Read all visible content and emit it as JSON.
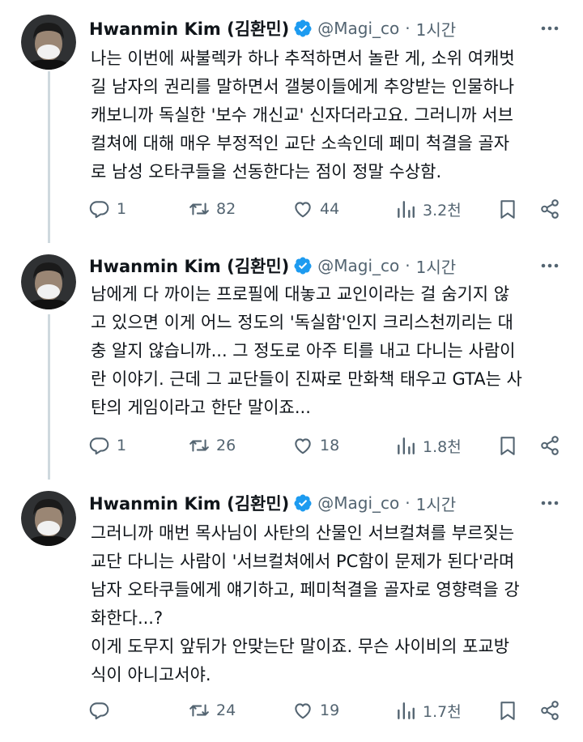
{
  "author": {
    "name": "Hwanmin Kim (김환민)",
    "handle": "@Magi_co",
    "separator": "·",
    "time": "1시간"
  },
  "colors": {
    "verified": "#1d9bf0",
    "icon": "#536471",
    "text": "#0f1419",
    "thread_line": "#cfd9de"
  },
  "tweets": [
    {
      "lines": [
        "나는 이번에 싸불렉카 하나 추적하면서 놀란 게, 소위 여캐벗",
        "길 남자의 권리를 말하면서 갤붕이들에게 추앙받는 인물하나",
        "캐보니까 독실한 '보수 개신교' 신자더라고요. 그러니까 서브",
        "컬쳐에 대해 매우 부정적인 교단 소속인데 페미 척결을 골자",
        "로 남성 오타쿠들을 선동한다는 점이 정말 수상함."
      ],
      "replies": "1",
      "reposts": "82",
      "likes": "44",
      "views": "3.2천"
    },
    {
      "lines": [
        "남에게 다 까이는 프로필에 대놓고 교인이라는 걸 숨기지 않",
        "고 있으면 이게 어느 정도의 '독실함'인지 크리스천끼리는 대",
        "충 알지 않습니까... 그 정도로 아주 티를 내고 다니는 사람이",
        "란 이야기. 근데 그 교단들이 진짜로 만화책 태우고 GTA는 사",
        "탄의 게임이라고 한단 말이죠..."
      ],
      "replies": "1",
      "reposts": "26",
      "likes": "18",
      "views": "1.8천"
    },
    {
      "lines": [
        "그러니까 매번 목사님이 사탄의 산물인 서브컬쳐를 부르짖는",
        "교단 다니는 사람이 '서브컬쳐에서 PC함이 문제가 된다'라며",
        "남자 오타쿠들에게 얘기하고, 페미척결을 골자로 영향력을 강",
        "화한다...?",
        "이게 도무지 앞뒤가 안맞는단 말이죠. 무슨 사이비의 포교방",
        "식이 아니고서야."
      ],
      "replies": "",
      "reposts": "24",
      "likes": "19",
      "views": "1.7천"
    }
  ]
}
